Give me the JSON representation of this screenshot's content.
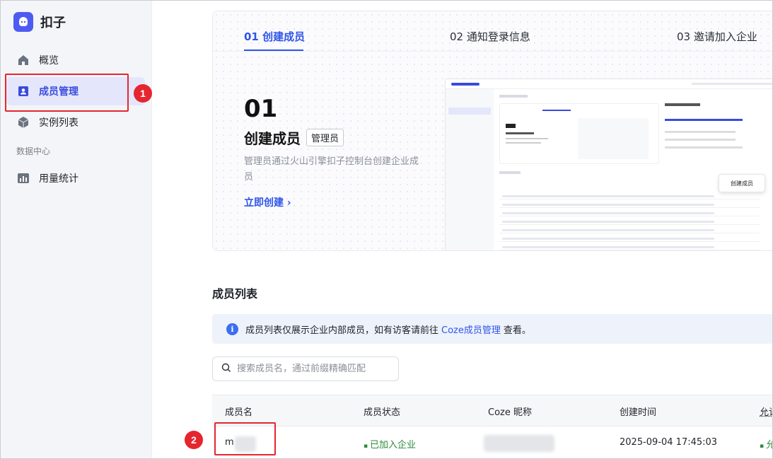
{
  "sidebar": {
    "brand": "扣子",
    "items": [
      {
        "label": "概览"
      },
      {
        "label": "成员管理"
      },
      {
        "label": "实例列表"
      }
    ],
    "section_label": "数据中心",
    "items2": [
      {
        "label": "用量统计"
      }
    ]
  },
  "steps": {
    "badge1": "1",
    "badge2": "2"
  },
  "banner": {
    "tabs": [
      {
        "label": "01 创建成员"
      },
      {
        "label": "02 通知登录信息"
      },
      {
        "label": "03 邀请加入企业"
      }
    ],
    "number": "01",
    "title": "创建成员",
    "tag": "管理员",
    "description": "管理员通过火山引擎扣子控制台创建企业成员",
    "link": "立即创建",
    "preview_button": "创建成员"
  },
  "members": {
    "title": "成员列表",
    "info_prefix": "成员列表仅展示企业内部成员，如有访客请前往",
    "info_link": "Coze成员管理",
    "info_suffix": "查看。",
    "search_placeholder": "搜索成员名，通过前缀精确匹配",
    "columns": [
      "成员名",
      "成员状态",
      "Coze 昵称",
      "创建时间",
      "允许"
    ],
    "rows": [
      {
        "name": "m",
        "status": "已加入企业",
        "created": "2025-09-04 17:45:03",
        "allow": "允"
      }
    ]
  },
  "colors": {
    "accent": "#2f54eb",
    "highlight": "#e5262f",
    "status_ok": "#2e8a3c"
  }
}
